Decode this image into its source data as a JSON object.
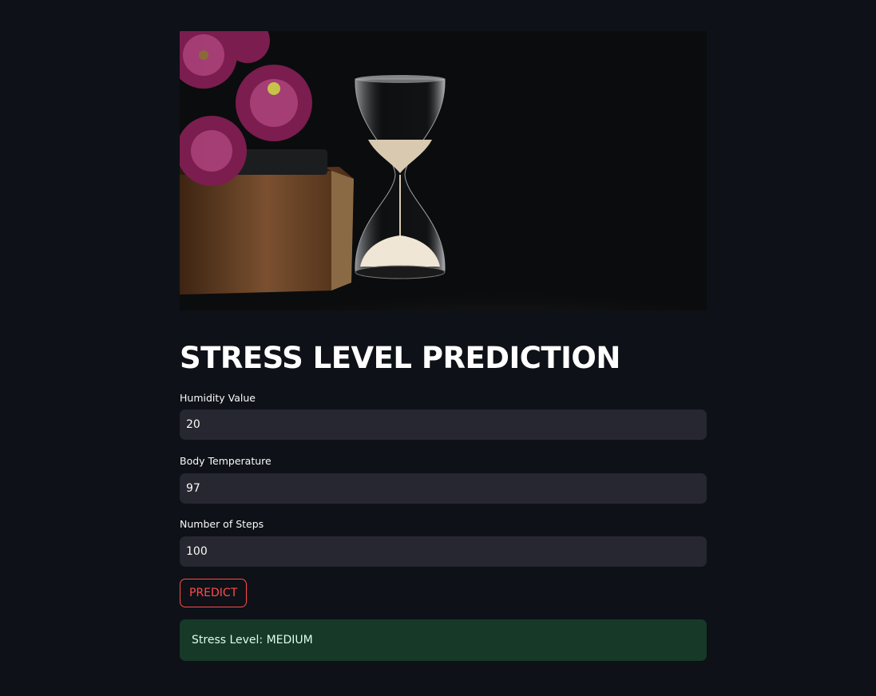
{
  "app": {
    "title": "STRESS LEVEL PREDICTION",
    "hero_image": "hourglass-book-flowers"
  },
  "form": {
    "fields": [
      {
        "label": "Humidity Value",
        "value": "20"
      },
      {
        "label": "Body Temperature",
        "value": "97"
      },
      {
        "label": "Number of Steps",
        "value": "100"
      }
    ],
    "predict_label": "PREDICT"
  },
  "result": {
    "text": "Stress Level: MEDIUM"
  },
  "colors": {
    "background": "#0e1117",
    "input_bg": "#262730",
    "accent": "#ff4b4b",
    "success_bg": "#173928"
  }
}
